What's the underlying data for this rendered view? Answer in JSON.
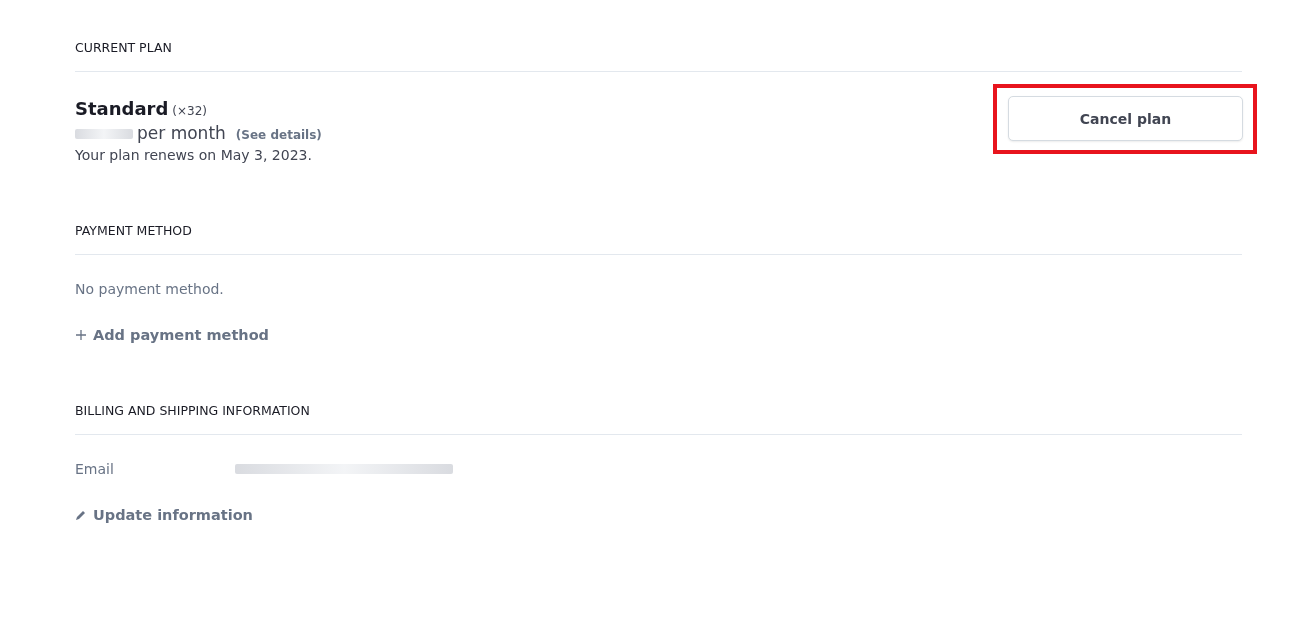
{
  "current_plan": {
    "heading": "CURRENT PLAN",
    "plan_name": "Standard",
    "quantity": "(×32)",
    "price_redacted": true,
    "period": "per month",
    "details_link": "(See details)",
    "renewal": "Your plan renews on May 3, 2023.",
    "cancel_button": {
      "label": "Cancel plan",
      "highlighted": true
    }
  },
  "payment_method": {
    "heading": "PAYMENT METHOD",
    "empty_text": "No payment method.",
    "add_link": "Add payment method"
  },
  "billing": {
    "heading": "BILLING AND SHIPPING INFORMATION",
    "fields": [
      {
        "label": "Email",
        "value_redacted": true
      }
    ],
    "update_link": "Update information"
  }
}
